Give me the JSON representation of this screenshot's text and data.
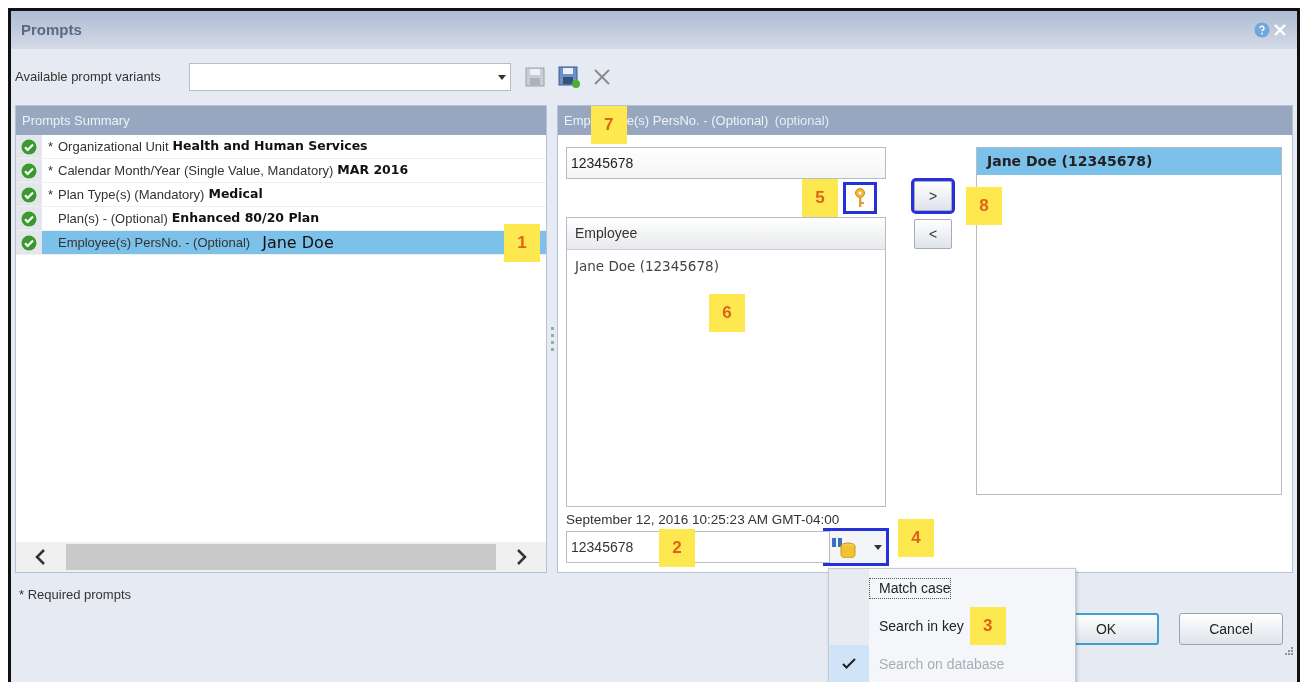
{
  "window": {
    "title": "Prompts"
  },
  "toolbar": {
    "label": "Available prompt variants"
  },
  "summary": {
    "title": "Prompts Summary",
    "items": [
      {
        "mark": "*",
        "label": "Organizational Unit",
        "value": "Health and Human Services",
        "kind": "bold",
        "selected": false
      },
      {
        "mark": "*",
        "label": "Calendar Month/Year (Single Value, Mandatory)",
        "value": "MAR 2016",
        "kind": "bold",
        "selected": false
      },
      {
        "mark": "*",
        "label": "Plan Type(s) (Mandatory)",
        "value": "Medical",
        "kind": "bold",
        "selected": false
      },
      {
        "label": "Plan(s) - (Optional)",
        "value": "Enhanced 80/20 Plan",
        "kind": "bold",
        "selected": false
      },
      {
        "label": "Employee(s) PersNo. - (Optional)",
        "value": "Jane Doe",
        "kind": "typed",
        "selected": true,
        "callout": "1"
      }
    ]
  },
  "prompt": {
    "heading_start": "Emp",
    "heading_end": "e(s) PersNo. - (Optional)",
    "hint": "(optional)",
    "callout": "7",
    "entry": {
      "value": "12345678"
    },
    "key_button": {
      "highlighted": true,
      "callout": "5"
    },
    "available": {
      "column": "Employee",
      "rows": [
        {
          "text": "Jane Doe (12345678)",
          "selected": false
        }
      ],
      "callout": "6"
    },
    "timestamp": "September 12, 2016 10:25:23 AM GMT-04:00",
    "search": {
      "value": "12345678",
      "callout": "2"
    },
    "search_button": {
      "highlighted": true,
      "callout": "4"
    },
    "add_button": {
      "label": ">",
      "highlighted": true,
      "callout": "8"
    },
    "remove_button": {
      "label": "<"
    },
    "selected_values": [
      {
        "text": "Jane Doe (12345678)",
        "selected": true
      }
    ]
  },
  "search_menu": {
    "items": [
      {
        "label": "Match case",
        "checked": false,
        "disabled": false,
        "focused": true
      },
      {
        "label": "Search in key",
        "checked": false,
        "disabled": false,
        "focused": false,
        "callout": "3"
      },
      {
        "label": "Search on database",
        "checked": true,
        "disabled": true,
        "focused": false
      }
    ]
  },
  "footer": {
    "note": "* Required prompts",
    "buttons": [
      {
        "label": "OK",
        "default": true
      },
      {
        "label": "Cancel",
        "default": false
      }
    ]
  }
}
